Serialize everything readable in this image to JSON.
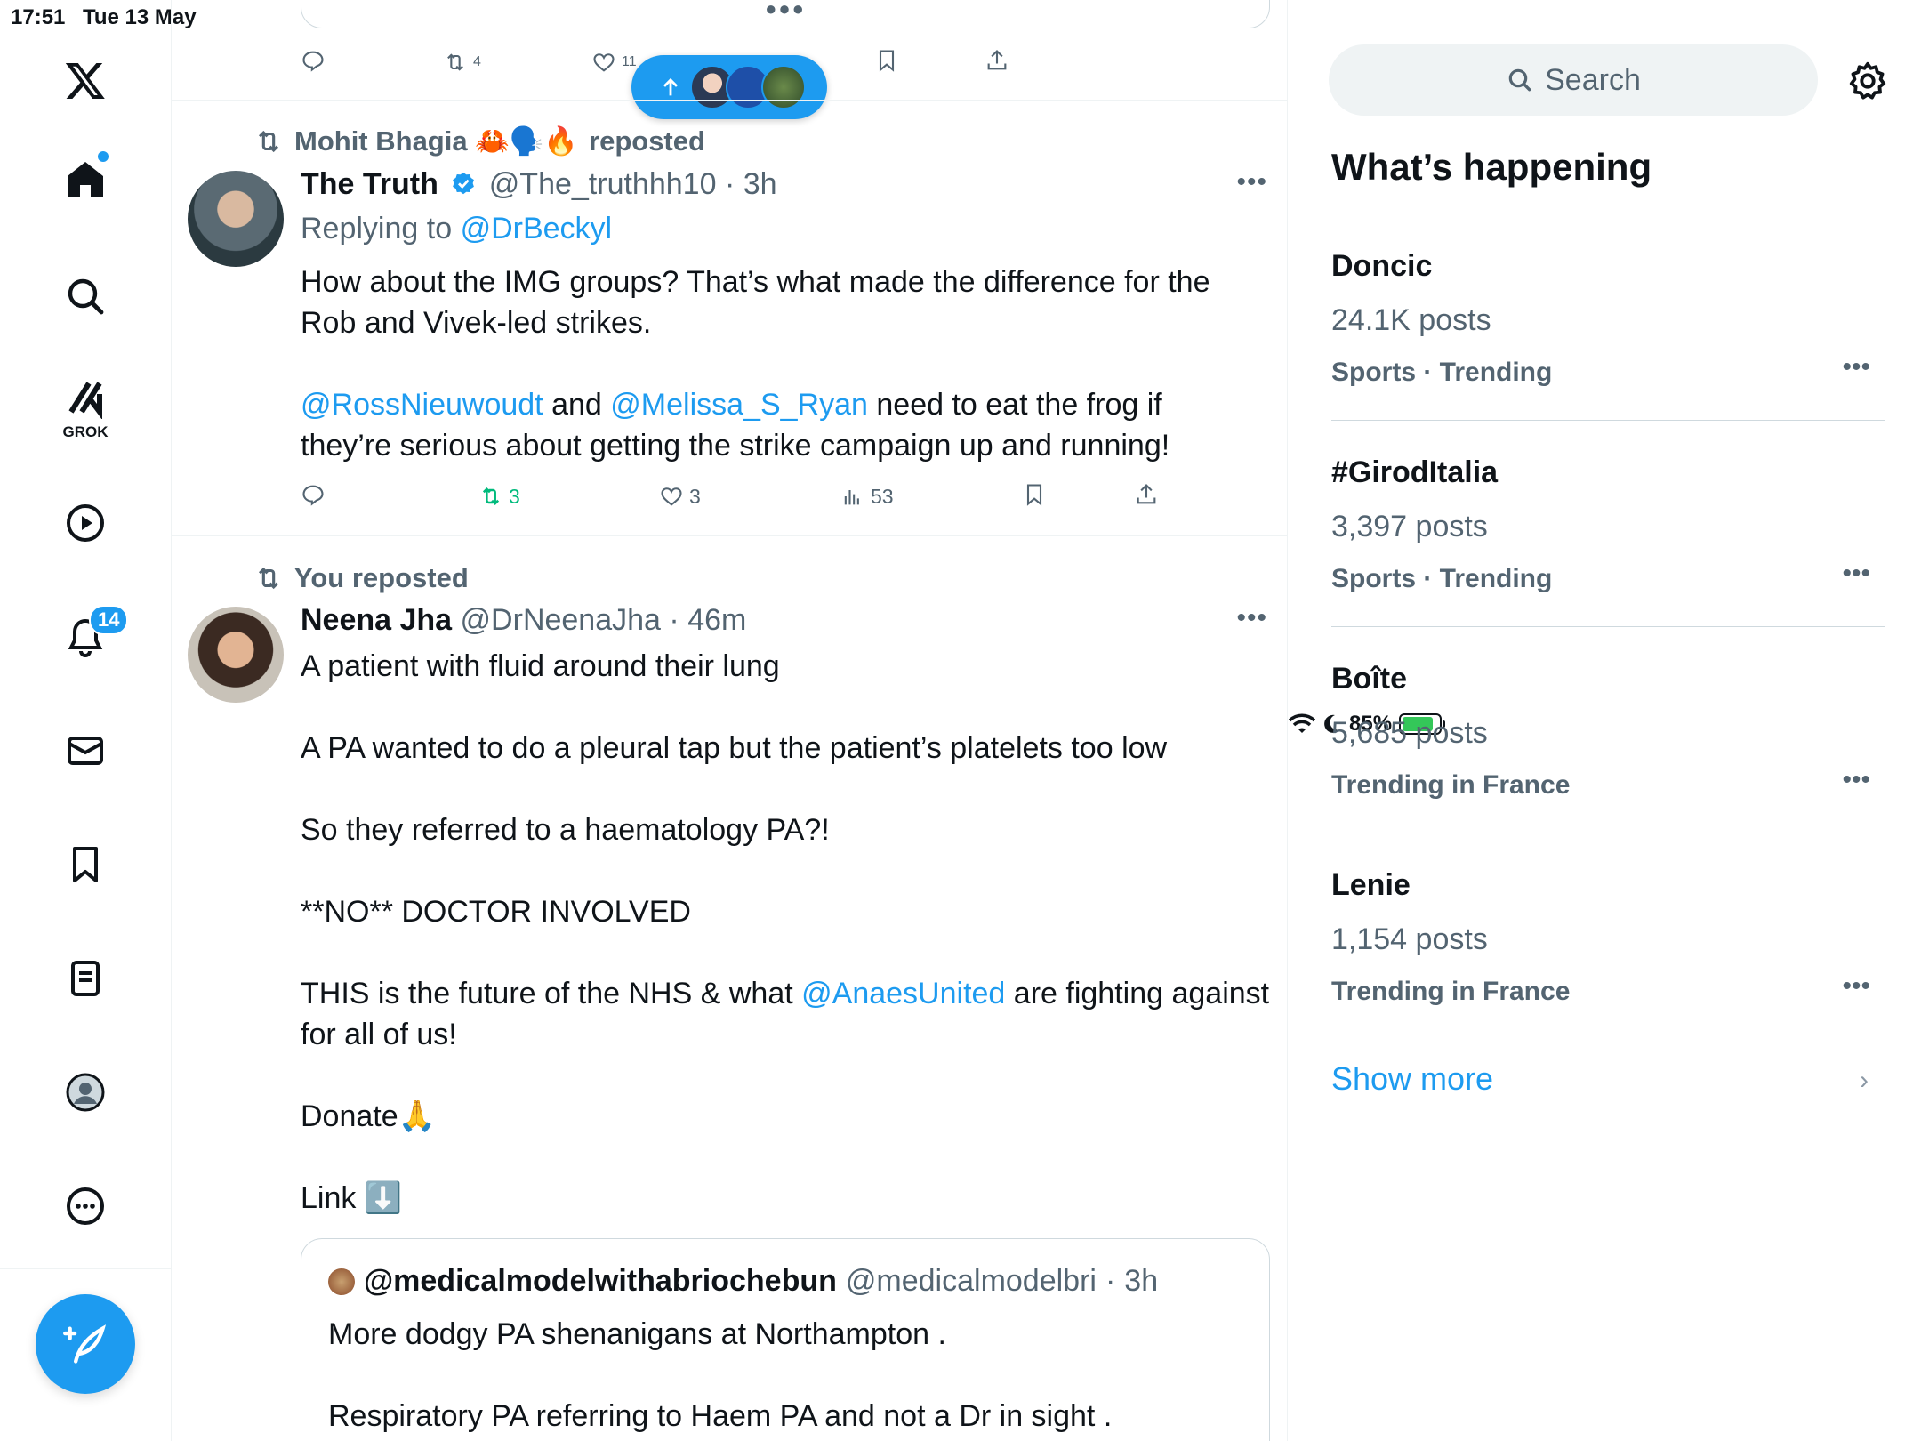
{
  "status_bar": {
    "time": "17:51",
    "date": "Tue 13 May",
    "battery": "85%",
    "battery_level": 0.85
  },
  "nav": {
    "grok_label": "GROK",
    "notifications_badge": "14"
  },
  "timeline": {
    "top_tweet": {
      "retweets": "4",
      "likes": "11"
    },
    "tweet1": {
      "reposted_by": "Mohit Bhagia 🦀🗣️🔥",
      "reposted_suffix": "reposted",
      "name": "The Truth",
      "handle": "@The_truthhh10",
      "time": "3h",
      "replying_prefix": "Replying to",
      "replying_to": "@DrBeckyl",
      "text_line1": "How about the IMG groups? That’s what made the difference for the Rob and Vivek-led strikes.",
      "mention1": "@RossNieuwoudt",
      "and_word": "and",
      "mention2": "@Melissa_S_Ryan",
      "text_line2": "need to eat the frog if they’re serious about getting the strike campaign up and running!",
      "retweets": "3",
      "likes": "3",
      "views": "53"
    },
    "tweet2": {
      "reposted_by": "You reposted",
      "name": "Neena Jha",
      "handle": "@DrNeenaJha",
      "time": "46m",
      "p1": "A patient with fluid around their lung",
      "p2": "A PA wanted to do a pleural tap but the patient’s platelets too low",
      "p3": "So they referred to a haematology PA?!",
      "p4": "**NO** DOCTOR INVOLVED",
      "p5_pre": "THIS is the future of the NHS & what",
      "p5_mention": "@AnaesUnited",
      "p5_post": "are fighting against for all of us!",
      "p6": "Donate🙏",
      "p7": "Link ⬇️",
      "quote": {
        "name": "@medicalmodelwithabriochebun",
        "handle": "@medicalmodelbri",
        "time": "3h",
        "line1": "More dodgy PA shenanigans at Northampton .",
        "line2": "Respiratory PA referring to Haem PA and not a Dr in sight ."
      }
    }
  },
  "sidebar": {
    "search_placeholder": "Search",
    "section_title": "What’s happening",
    "trends": [
      {
        "name": "Doncic",
        "posts": "24.1K posts",
        "meta": "Sports · Trending"
      },
      {
        "name": "#GirodItalia",
        "posts": "3,397 posts",
        "meta": "Sports · Trending"
      },
      {
        "name": "Boîte",
        "posts": "5,685 posts",
        "meta": "Trending in France"
      },
      {
        "name": "Lenie",
        "posts": "1,154 posts",
        "meta": "Trending in France"
      }
    ],
    "show_more": "Show more"
  },
  "colors": {
    "accent": "#1d9bf0",
    "muted": "#536471",
    "retweet_green": "#00ba7c",
    "text": "#0f1419"
  },
  "icons": [
    "x-logo-icon",
    "home-icon",
    "search-icon",
    "grok-icon",
    "video-icon",
    "bell-icon",
    "mail-icon",
    "bookmark-icon",
    "list-icon",
    "profile-icon",
    "more-icon",
    "compose-icon",
    "reply-icon",
    "retweet-icon",
    "heart-icon",
    "views-icon",
    "share-icon",
    "gear-icon",
    "verified-icon"
  ]
}
